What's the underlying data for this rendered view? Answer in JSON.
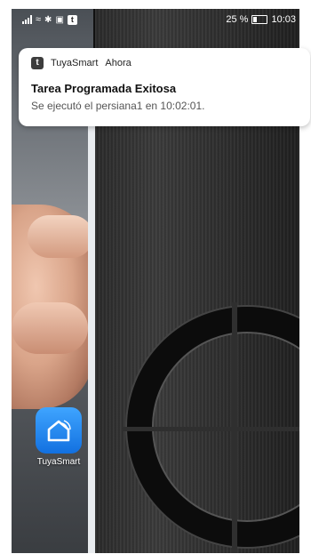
{
  "status_bar": {
    "battery_percent": "25 %",
    "time": "10:03"
  },
  "notification": {
    "app_name": "TuyaSmart",
    "time_label": "Ahora",
    "title": "Tarea Programada Exitosa",
    "body": "Se ejecutó el persiana1 en 10:02:01."
  },
  "home_screen": {
    "apps": [
      {
        "label": "TuyaSmart",
        "icon": "tuya-smart-icon",
        "color": "#1a7ff0"
      }
    ]
  }
}
